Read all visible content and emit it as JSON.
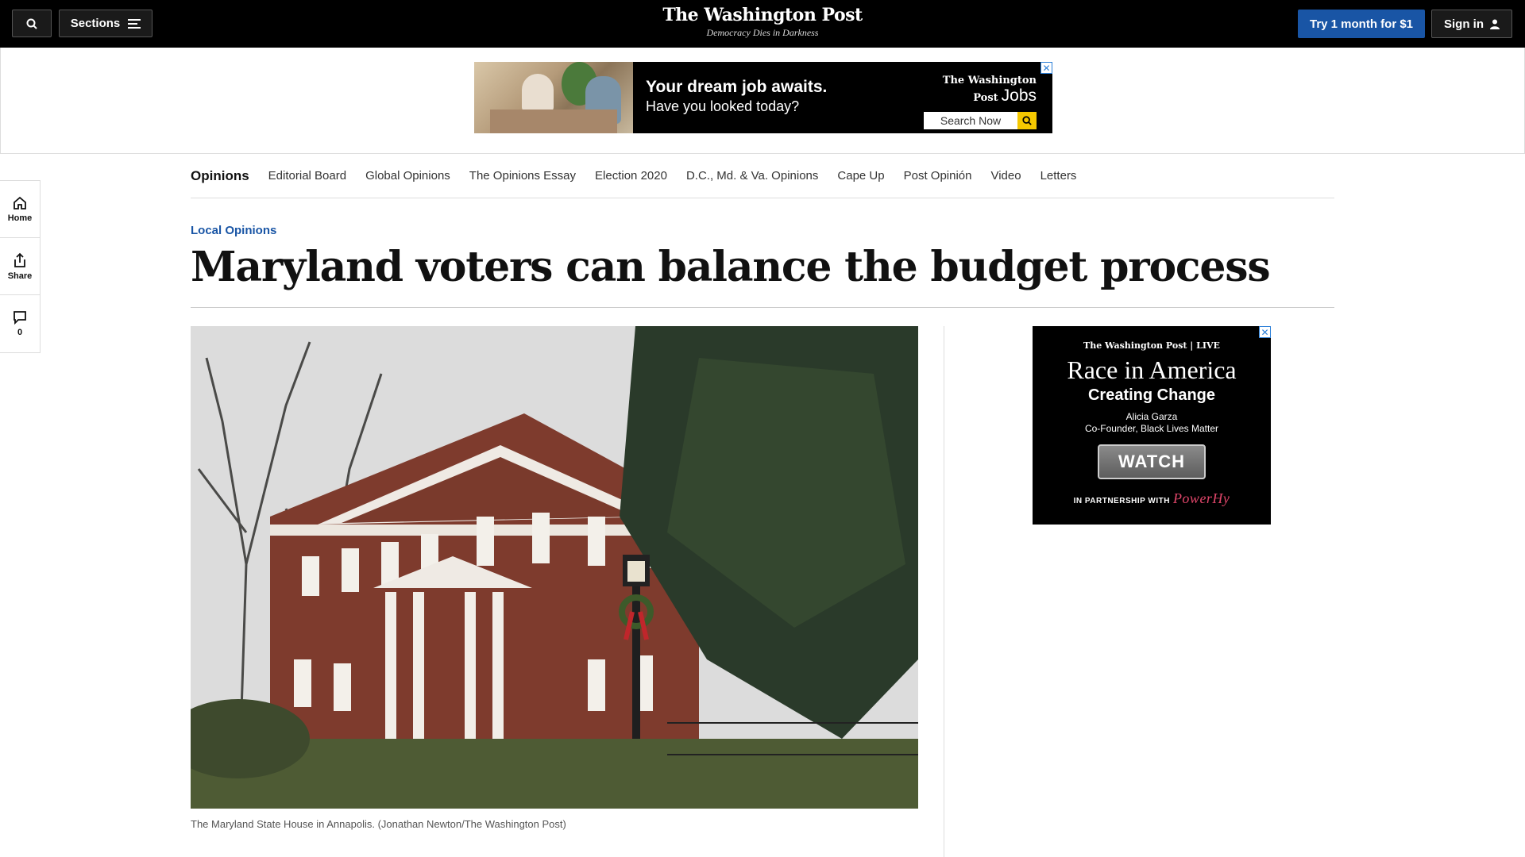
{
  "masthead": {
    "sections_label": "Sections",
    "logo": "The Washington Post",
    "tagline": "Democracy Dies in Darkness",
    "try_label": "Try 1 month for $1",
    "signin_label": "Sign in"
  },
  "top_ad": {
    "headline": "Your dream job awaits.",
    "subline": "Have you looked today?",
    "brand": "The Washington Post",
    "brand_suffix": "Jobs",
    "search_label": "Search Now",
    "close": "✕"
  },
  "section_nav": {
    "items": [
      "Opinions",
      "Editorial Board",
      "Global Opinions",
      "The Opinions Essay",
      "Election 2020",
      "D.C., Md. & Va. Opinions",
      "Cape Up",
      "Post Opinión",
      "Video",
      "Letters"
    ]
  },
  "left_rail": {
    "home": "Home",
    "share": "Share",
    "comments": "0"
  },
  "article": {
    "kicker": "Local Opinions",
    "headline": "Maryland voters can balance the budget process",
    "caption": "The Maryland State House in Annapolis. (Jonathan Newton/The Washington Post)"
  },
  "side_ad": {
    "brand": "The Washington Post | LIVE",
    "title": "Race in America",
    "subtitle": "Creating Change",
    "person": "Alicia Garza",
    "role": "Co-Founder, Black Lives Matter",
    "watch": "WATCH",
    "partner": "IN PARTNERSHIP WITH",
    "partner_name": "PowerHy",
    "close": "✕"
  },
  "colors": {
    "accent": "#1955a5",
    "masthead_bg": "#000000"
  }
}
